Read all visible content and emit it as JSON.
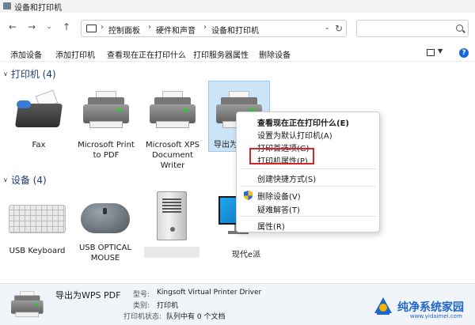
{
  "window": {
    "title": "设备和打印机"
  },
  "nav": {
    "back": "←",
    "forward": "→",
    "recent": "⌄",
    "up": "↑",
    "breadcrumbs": [
      "控制面板",
      "硬件和声音",
      "设备和打印机"
    ],
    "separator": "›",
    "dropdown": "⌄",
    "refresh": "↻",
    "search_placeholder": ""
  },
  "commands": [
    "添加设备",
    "添加打印机",
    "查看现在正在打印什么",
    "打印服务器属性",
    "删除设备"
  ],
  "help_icon": "?",
  "groups": {
    "printers": {
      "chevron": "∨",
      "header": "打印机 (4)"
    },
    "devices": {
      "chevron": "∨",
      "header": "设备 (4)"
    }
  },
  "printers": [
    {
      "icon": "fax-icon",
      "label": "Fax"
    },
    {
      "icon": "printer-icon",
      "label": "Microsoft Print to PDF"
    },
    {
      "icon": "printer-icon",
      "label": "Microsoft XPS Document Writer"
    },
    {
      "icon": "printer-icon",
      "label": "导出为V",
      "selected": true
    }
  ],
  "devices": [
    {
      "icon": "keyboard-icon",
      "label": "USB Keyboard"
    },
    {
      "icon": "mouse-icon",
      "label": "USB OPTICAL MOUSE"
    },
    {
      "icon": "computer-tower-icon",
      "label": ""
    },
    {
      "icon": "monitor-icon",
      "label": "现代e派"
    }
  ],
  "context_menu": {
    "items": [
      {
        "label": "查看现在正在打印什么(E)",
        "bold": true
      },
      {
        "label": "设置为默认打印机(A)"
      },
      {
        "label": "打印首选项(G)"
      },
      {
        "label": "打印机属性(P)",
        "highlighted": true
      },
      {
        "label": "创建快捷方式(S)"
      },
      {
        "label": "删除设备(V)",
        "icon": "shield-icon"
      },
      {
        "label": "疑难解答(T)"
      },
      {
        "label": "属性(R)"
      }
    ],
    "highlight_color": "#d9252a"
  },
  "details": {
    "name": "导出为WPS PDF",
    "model_label": "型号:",
    "model_value": "Kingsoft Virtual Printer Driver",
    "category_label": "类别:",
    "category_value": "打印机",
    "status_label": "打印机状态:",
    "status_value": "队列中有 0 个文档"
  },
  "watermark": {
    "text": "纯净系统家园",
    "url": "www.yidaimei.com"
  },
  "colors": {
    "accent": "#1668d6",
    "group_header": "#1f3a73",
    "selection": "#cce4f7"
  }
}
